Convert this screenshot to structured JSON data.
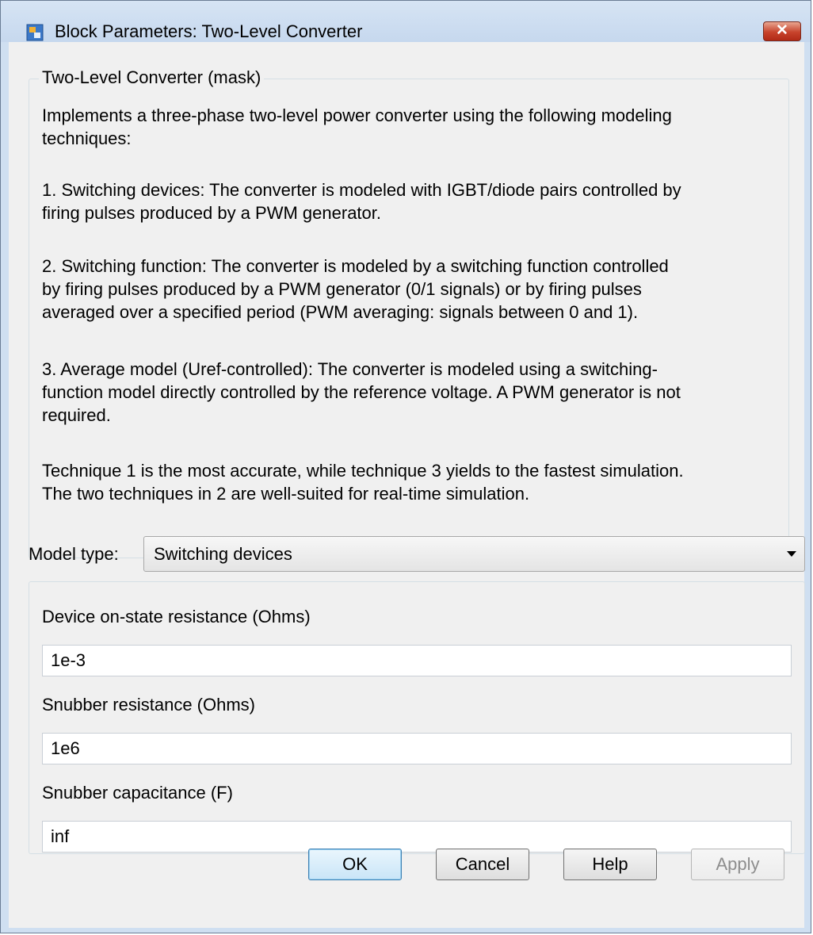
{
  "window": {
    "title": "Block Parameters: Two-Level Converter",
    "close_icon": "close-icon",
    "close_label": "✕"
  },
  "mask": {
    "group_title": "Two-Level Converter (mask)",
    "paragraphs": [
      "Implements a three-phase two-level power converter using the following modeling\ntechniques:",
      "1. Switching devices: The converter is modeled with IGBT/diode pairs controlled by\nfiring pulses produced by a PWM generator.",
      "2. Switching function: The converter is modeled by a switching function controlled\nby firing pulses produced by a PWM generator (0/1 signals) or by firing pulses\naveraged over a specified period (PWM averaging: signals between 0 and 1).",
      "3. Average model (Uref-controlled): The converter is modeled using a switching-\nfunction model directly controlled by the reference voltage. A PWM generator is not\nrequired.",
      "Technique 1 is the most accurate, while technique 3 yields to the fastest simulation.\nThe two techniques in 2 are well-suited for real-time simulation."
    ]
  },
  "model_type": {
    "label": "Model type:",
    "value": "Switching devices"
  },
  "parameters": [
    {
      "label": "Device on-state resistance (Ohms)",
      "value": "1e-3"
    },
    {
      "label": "Snubber resistance (Ohms)",
      "value": "1e6"
    },
    {
      "label": "Snubber capacitance (F)",
      "value": "inf"
    }
  ],
  "buttons": {
    "ok": "OK",
    "cancel": "Cancel",
    "help": "Help",
    "apply": "Apply"
  },
  "colors": {
    "frame": "#cfdff1",
    "client": "#f0f0f0",
    "close_button": "#c7432c"
  }
}
